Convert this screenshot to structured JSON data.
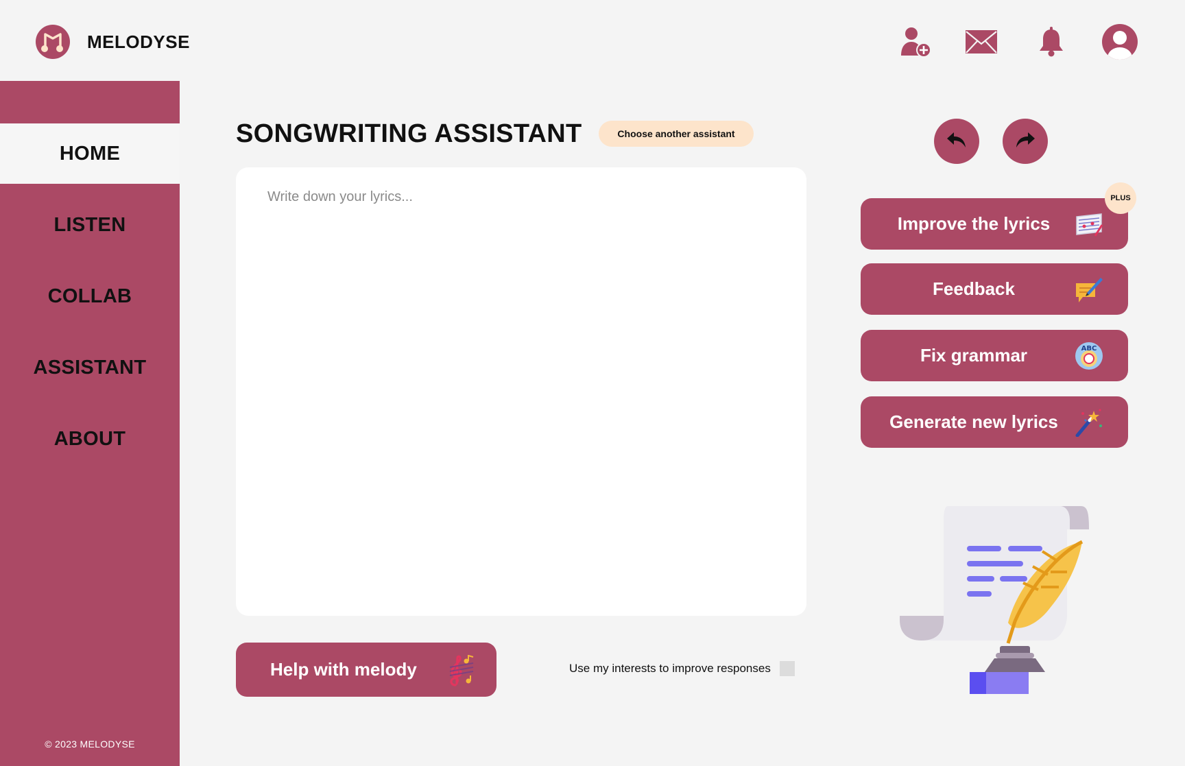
{
  "app": {
    "brand": "MELODYSE",
    "accent_color": "#ab4965",
    "soft_accent_color": "#fde4cb"
  },
  "header": {
    "icons": [
      "add-user-icon",
      "mail-icon",
      "bell-icon",
      "user-avatar-icon"
    ]
  },
  "sidebar": {
    "items": [
      {
        "label": "HOME",
        "active": true
      },
      {
        "label": "LISTEN",
        "active": false
      },
      {
        "label": "COLLAB",
        "active": false
      },
      {
        "label": "ASSISTANT",
        "active": false
      },
      {
        "label": "ABOUT",
        "active": false
      }
    ],
    "copyright": "© 2023 MELODYSE"
  },
  "main": {
    "title": "SONGWRITING ASSISTANT",
    "choose_assistant_label": "Choose another assistant",
    "lyrics_placeholder": "Write down your lyrics...",
    "lyrics_value": "",
    "help_melody_label": "Help with melody",
    "interests_label": "Use my interests to improve responses",
    "interests_checked": false
  },
  "right_panel": {
    "undo_icon": "undo-arrow-icon",
    "redo_icon": "redo-arrow-icon",
    "plus_badge": "PLUS",
    "actions": [
      {
        "label": "Improve the lyrics",
        "icon": "sheet-music-icon"
      },
      {
        "label": "Feedback",
        "icon": "memo-pencil-icon"
      },
      {
        "label": "Fix grammar",
        "icon": "abc-badge-icon"
      },
      {
        "label": "Generate new lyrics",
        "icon": "magic-wand-icon"
      }
    ],
    "illustration": "scroll-quill-illustration"
  }
}
